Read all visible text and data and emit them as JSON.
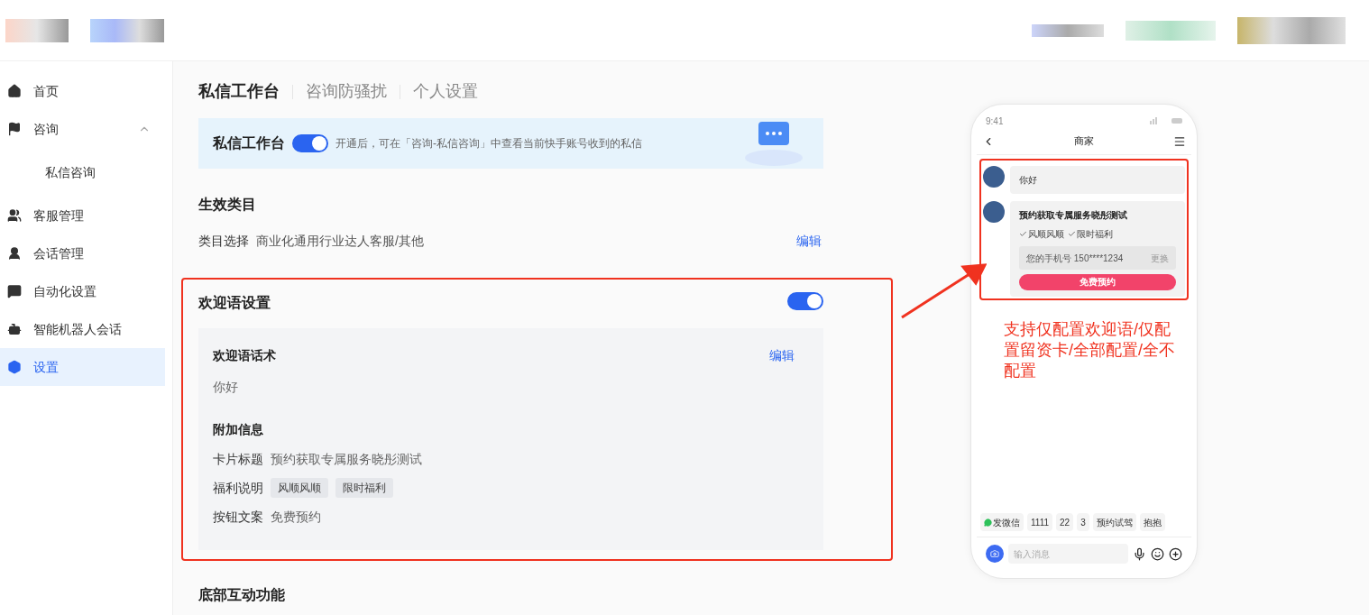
{
  "sidebar": {
    "items": [
      {
        "label": "首页",
        "selected": false
      },
      {
        "label": "咨询",
        "selected": false,
        "expanded": true,
        "children": [
          {
            "label": "私信咨询",
            "selected": false
          }
        ]
      },
      {
        "label": "客服管理",
        "selected": false
      },
      {
        "label": "会话管理",
        "selected": false
      },
      {
        "label": "自动化设置",
        "selected": false
      },
      {
        "label": "智能机器人会话",
        "selected": false
      },
      {
        "label": "设置",
        "selected": true
      }
    ]
  },
  "tabs": [
    {
      "label": "私信工作台",
      "selected": true
    },
    {
      "label": "咨询防骚扰",
      "selected": false
    },
    {
      "label": "个人设置",
      "selected": false
    }
  ],
  "banner": {
    "title": "私信工作台",
    "on": true,
    "description": "开通后，可在「咨询-私信咨询」中查看当前快手账号收到的私信"
  },
  "category": {
    "title": "生效类目",
    "label": "类目选择",
    "value": "商业化通用行业达人客服/其他",
    "edit": "编辑"
  },
  "welcome": {
    "title": "欢迎语设置",
    "on": true,
    "script_title": "欢迎语话术",
    "edit": "编辑",
    "script_text": "你好",
    "extra_title": "附加信息",
    "fields": [
      {
        "kind": "text",
        "label": "卡片标题",
        "value": "预约获取专属服务晓彤测试"
      },
      {
        "kind": "tags",
        "label": "福利说明",
        "tags": [
          "风顺风顺",
          "限时福利"
        ]
      },
      {
        "kind": "text",
        "label": "按钮文案",
        "value": "免费预约"
      }
    ]
  },
  "bottom_section": {
    "title": "底部互动功能"
  },
  "phone": {
    "time": "9:41",
    "title": "商家",
    "messages": [
      {
        "kind": "text",
        "text": "你好"
      },
      {
        "kind": "card",
        "title": "预约获取专属服务晓彤测试",
        "benefits": [
          "风顺风顺",
          "限时福利"
        ],
        "phone_field": "您的手机号 150****1234",
        "change": "更换",
        "button": "免费预约"
      }
    ],
    "quick_replies": [
      {
        "kind": "wechat",
        "label": "发微信"
      },
      {
        "kind": "plain",
        "label": "1111"
      },
      {
        "kind": "plain",
        "label": "22"
      },
      {
        "kind": "plain",
        "label": "3"
      },
      {
        "kind": "plain",
        "label": "预约试驾"
      },
      {
        "kind": "plain",
        "label": "抱抱"
      }
    ],
    "input_placeholder": "输入消息"
  },
  "annotation": {
    "text": "支持仅配置欢迎语/仅配置留资卡/全部配置/全不配置"
  }
}
